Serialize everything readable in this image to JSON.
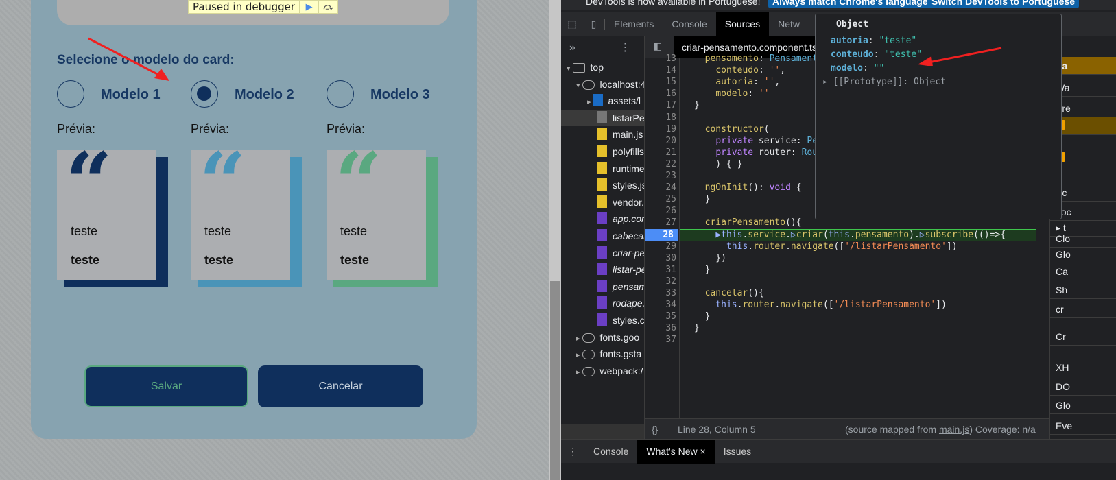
{
  "page": {
    "debugger_banner": "Paused in debugger",
    "resume_icon": "resume-icon",
    "step_over_icon": "step-over-icon",
    "heading": "Selecione o modelo do card:",
    "models": [
      {
        "label": "Modelo 1",
        "selected": false,
        "color": "#0f2f5c"
      },
      {
        "label": "Modelo 2",
        "selected": true,
        "color": "#4a94b8"
      },
      {
        "label": "Modelo 3",
        "selected": false,
        "color": "#5aa880"
      }
    ],
    "preview_label": "Prévia:",
    "card_text": "teste",
    "card_author": "teste",
    "save_label": "Salvar",
    "cancel_label": "Cancelar"
  },
  "devtools": {
    "banner": {
      "text": "DevTools is now available in Portuguese!",
      "btn1": "Always match Chrome's language",
      "btn2": "Switch DevTools to Portuguese"
    },
    "tabs": [
      "Elements",
      "Console",
      "Sources",
      "Netw"
    ],
    "active_tab": "Sources",
    "navigator": [
      "top",
      "localhost:4",
      "assets/l",
      "listarPer",
      "main.js",
      "polyfills",
      "runtime",
      "styles.js",
      "vendor.",
      "app.con",
      "cabecal",
      "criar-pe",
      "listar-pe",
      "pensam",
      "rodape.",
      "styles.cs",
      "fonts.goo",
      "fonts.gsta",
      "webpack:/"
    ],
    "file_tab": "criar-pensamento.component.ts",
    "code": [
      {
        "n": "13",
        "html": "  <span class='f'>pensamento</span>: <span class='ty'>Pensamento</span> = {"
      },
      {
        "n": "14",
        "html": "    <span class='f'>conteudo</span>: <span class='s'>''</span>,"
      },
      {
        "n": "15",
        "html": "    <span class='f'>autoria</span>: <span class='s'>''</span>,"
      },
      {
        "n": "16",
        "html": "    <span class='f'>modelo</span>: <span class='s'>''</span>"
      },
      {
        "n": "17",
        "html": "}"
      },
      {
        "n": "18",
        "html": ""
      },
      {
        "n": "19",
        "html": "  <span class='f'>constructor</span>("
      },
      {
        "n": "20",
        "html": "    <span class='k'>private</span> service: <span class='ty'>PensamentoService</span>,"
      },
      {
        "n": "21",
        "html": "    <span class='k'>private</span> router: <span class='ty'>Router</span>"
      },
      {
        "n": "22",
        "html": "    ) { }"
      },
      {
        "n": "23",
        "html": ""
      },
      {
        "n": "24",
        "html": "  <span class='f'>ngOnInit</span>(): <span class='k'>void</span> {"
      },
      {
        "n": "25",
        "html": "  }"
      },
      {
        "n": "26",
        "html": ""
      },
      {
        "n": "27",
        "html": "  <span class='f'>criarPensamento</span>(){"
      },
      {
        "n": "28",
        "html": "    <span class='t'>▶this</span>.<span class='f'>service</span>.<span class='t'>▷</span><span class='f'>criar</span>(<span class='t'>this</span>.<span class='f'>pensamento</span>).<span class='t'>▷</span><span class='f'>subscribe</span>(()=>{"
      },
      {
        "n": "29",
        "html": "      <span class='t'>this</span>.<span class='f'>router</span>.<span class='f'>navigate</span>([<span class='s'>'/listarPensamento'</span>])"
      },
      {
        "n": "30",
        "html": "    })"
      },
      {
        "n": "31",
        "html": "  }"
      },
      {
        "n": "32",
        "html": ""
      },
      {
        "n": "33",
        "html": "  <span class='f'>cancelar</span>(){"
      },
      {
        "n": "34",
        "html": "    <span class='t'>this</span>.<span class='f'>router</span>.<span class='f'>navigate</span>([<span class='s'>'/listarPensamento'</span>])"
      },
      {
        "n": "35",
        "html": "  }"
      },
      {
        "n": "36",
        "html": "}"
      },
      {
        "n": "37",
        "html": ""
      }
    ],
    "popover": {
      "title": "Object",
      "autoria_key": "autoria",
      "autoria_val": "\"teste\"",
      "conteudo_key": "conteudo",
      "conteudo_val": "\"teste\"",
      "modelo_key": "modelo",
      "modelo_val": "\"\"",
      "proto": "[[Prototype]]: Object"
    },
    "status": {
      "position": "Line 28, Column 5",
      "mapped_prefix": "(source mapped from ",
      "mapped_link": "main.js",
      "mapped_suffix": ")",
      "coverage": "Coverage: n/a"
    },
    "drawer": [
      "Console",
      "What's New",
      "Issues"
    ],
    "sidebar": [
      "Pa",
      "Wa",
      "Bre",
      "",
      "",
      "Sc",
      "Loc",
      "▸ t",
      "Clo",
      "Glo",
      "Ca",
      "Sh",
      "cr",
      "Cr",
      "XH",
      "DO",
      "Glo",
      "Eve"
    ]
  }
}
